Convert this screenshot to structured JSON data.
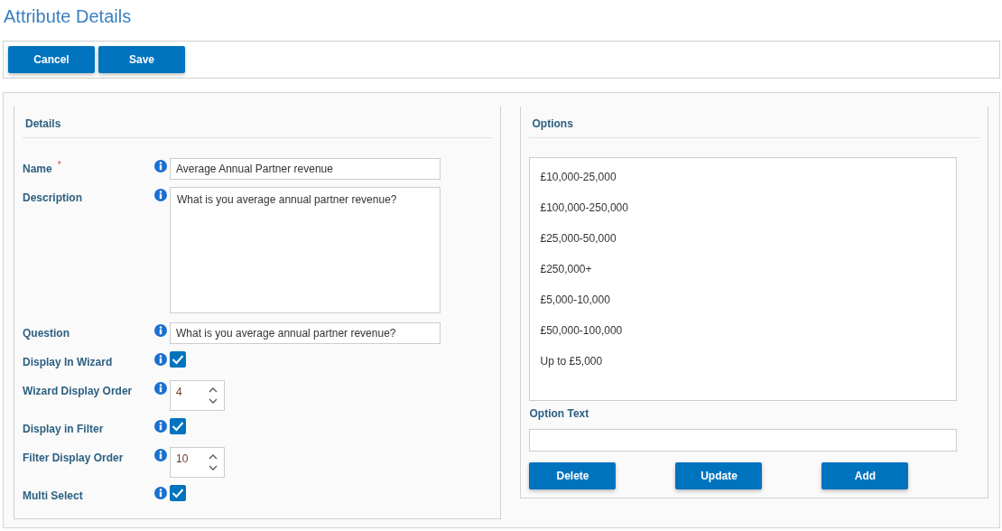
{
  "page_title": "Attribute Details",
  "toolbar": {
    "buttons": [
      "Cancel",
      "Save"
    ]
  },
  "details": {
    "title": "Details",
    "fields": [
      {
        "kind": "text",
        "label": "Name",
        "required_mark": "*",
        "value": "Average Annual Partner revenue"
      },
      {
        "kind": "textarea",
        "label": "Description",
        "value": "What is you average annual partner revenue?"
      },
      {
        "kind": "text",
        "label": "Question",
        "value": "What is you average annual partner revenue?"
      },
      {
        "kind": "checkbox",
        "label": "Display In Wizard",
        "checked": true
      },
      {
        "kind": "number",
        "label": "Wizard Display Order",
        "value": "4"
      },
      {
        "kind": "checkbox",
        "label": "Display in Filter",
        "checked": true
      },
      {
        "kind": "number",
        "label": "Filter Display Order",
        "value": "10"
      },
      {
        "kind": "checkbox",
        "label": "Multi Select",
        "checked": true
      }
    ]
  },
  "options": {
    "title": "Options",
    "items": [
      "£10,000-25,000",
      "£100,000-250,000",
      "£25,000-50,000",
      "£250,000+",
      "£5,000-10,000",
      "£50,000-100,000",
      "Up to £5,000"
    ],
    "option_text_label": "Option Text",
    "buttons": [
      "Delete",
      "Update",
      "Add"
    ]
  }
}
